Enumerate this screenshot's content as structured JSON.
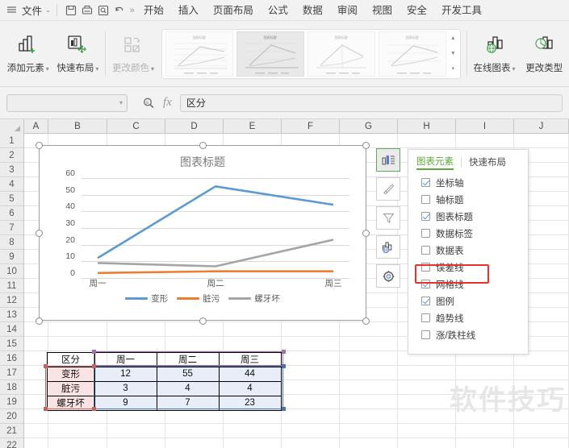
{
  "titlebar": {
    "menu_icon": "hamburger-icon",
    "file_label": "文件",
    "file_caret": "⌄",
    "quick_icons": [
      "save-icon",
      "print-icon",
      "print-preview-icon",
      "undo-icon"
    ],
    "more_chevron": "»",
    "tabs": [
      {
        "label": "开始"
      },
      {
        "label": "插入"
      },
      {
        "label": "页面布局"
      },
      {
        "label": "公式"
      },
      {
        "label": "数据"
      },
      {
        "label": "审阅"
      },
      {
        "label": "视图"
      },
      {
        "label": "安全"
      },
      {
        "label": "开发工具"
      }
    ]
  },
  "ribbon": {
    "buttons": [
      {
        "label": "添加元素",
        "caret": "▾",
        "icon": "add-element-icon",
        "dimmed": false
      },
      {
        "label": "快速布局",
        "caret": "▾",
        "icon": "quick-layout-icon",
        "dimmed": false
      },
      {
        "label": "更改颜色",
        "caret": "▾",
        "icon": "change-color-icon",
        "dimmed": true
      }
    ],
    "right_buttons": [
      {
        "label": "在线图表",
        "caret": "▾",
        "icon": "online-chart-icon"
      },
      {
        "label": "更改类型",
        "caret": "",
        "icon": "change-type-icon"
      }
    ],
    "gallery": {
      "thumb_title": "图表标题",
      "thumbs": [
        {
          "selected": false
        },
        {
          "selected": true
        },
        {
          "selected": false
        },
        {
          "selected": false
        }
      ],
      "scroll_up": "▲",
      "scroll_down": "▼",
      "scroll_more": "▾"
    }
  },
  "formula_bar": {
    "name_box_value": "",
    "name_box_caret": "▾",
    "search_icon": "magnifier-icon",
    "fx_label": "fx",
    "formula_value": "区分"
  },
  "sheet": {
    "columns": [
      "A",
      "B",
      "C",
      "D",
      "E",
      "F",
      "G",
      "H",
      "I",
      "J"
    ],
    "rows": [
      "1",
      "2",
      "3",
      "4",
      "5",
      "6",
      "7",
      "8",
      "9",
      "10",
      "11",
      "12",
      "13",
      "14",
      "15",
      "16",
      "17",
      "18",
      "19",
      "20",
      "21",
      "22"
    ],
    "watermark": "软件技巧"
  },
  "chart": {
    "title": "图表标题",
    "handles": 8,
    "colors": {
      "series1": "#5b9bd5",
      "series2": "#ed7d31",
      "series3": "#a5a5a5"
    }
  },
  "chart_data": {
    "type": "line",
    "title": "图表标题",
    "categories": [
      "周一",
      "周二",
      "周三"
    ],
    "series": [
      {
        "name": "变形",
        "values": [
          12,
          55,
          44
        ],
        "color": "#5b9bd5"
      },
      {
        "name": "脏污",
        "values": [
          3,
          4,
          4
        ],
        "color": "#ed7d31"
      },
      {
        "name": "螺牙坏",
        "values": [
          9,
          7,
          23
        ],
        "color": "#a5a5a5"
      }
    ],
    "xlabel": "",
    "ylabel": "",
    "ylim": [
      0,
      60
    ],
    "yticks": [
      0,
      10,
      20,
      30,
      40,
      50,
      60
    ],
    "grid": true,
    "legend": "bottom"
  },
  "floating_toolbar": {
    "buttons": [
      {
        "icon": "chart-elements-icon",
        "active": true
      },
      {
        "icon": "chart-style-brush-icon",
        "active": false
      },
      {
        "icon": "chart-filter-icon",
        "active": false
      },
      {
        "icon": "online-chart-icon",
        "active": false
      },
      {
        "icon": "chart-settings-gear-icon",
        "active": false
      }
    ]
  },
  "panel": {
    "tabs": [
      {
        "label": "图表元素",
        "active": true
      },
      {
        "label": "快速布局",
        "active": false
      }
    ],
    "items": [
      {
        "label": "坐标轴",
        "checked": true,
        "highlighted": false
      },
      {
        "label": "轴标题",
        "checked": false,
        "highlighted": false
      },
      {
        "label": "图表标题",
        "checked": true,
        "highlighted": false
      },
      {
        "label": "数据标签",
        "checked": false,
        "highlighted": false
      },
      {
        "label": "数据表",
        "checked": false,
        "highlighted": false
      },
      {
        "label": "误差线",
        "checked": false,
        "highlighted": true
      },
      {
        "label": "网格线",
        "checked": true,
        "highlighted": false
      },
      {
        "label": "图例",
        "checked": true,
        "highlighted": false
      },
      {
        "label": "趋势线",
        "checked": false,
        "highlighted": false
      },
      {
        "label": "涨/跌柱线",
        "checked": false,
        "highlighted": false
      }
    ],
    "highlight_color": "#e8312f"
  },
  "data_table": {
    "header": [
      "区分",
      "周一",
      "周二",
      "周三"
    ],
    "rows": [
      {
        "label": "变形",
        "values": [
          "12",
          "55",
          "44"
        ]
      },
      {
        "label": "脏污",
        "values": [
          "3",
          "4",
          "4"
        ]
      },
      {
        "label": "螺牙坏",
        "values": [
          "9",
          "7",
          "23"
        ]
      }
    ]
  }
}
